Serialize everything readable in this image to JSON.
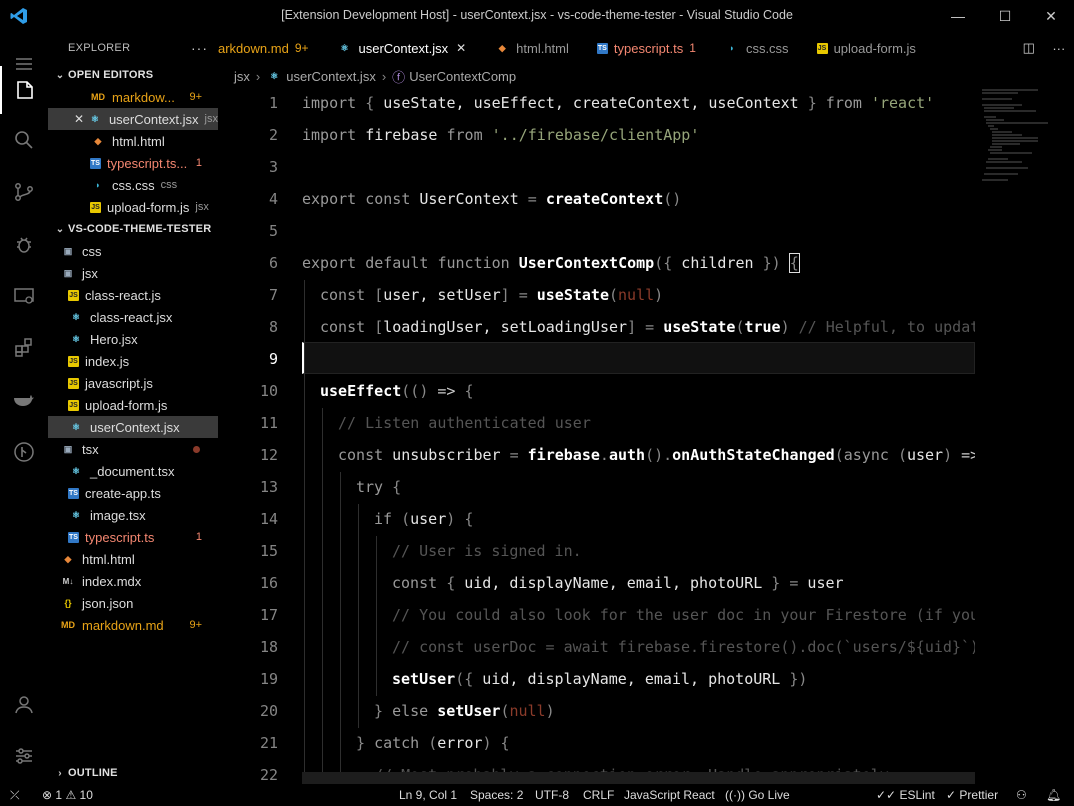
{
  "window": {
    "title": "[Extension Development Host] - userContext.jsx - vs-code-theme-tester - Visual Studio Code",
    "controls": {
      "minimize": "—",
      "maximize": "☐",
      "close": "✕"
    }
  },
  "activity_bar": {
    "items": [
      "files-icon",
      "search-icon",
      "source-control-icon",
      "debug-icon",
      "remote-explorer-icon",
      "extensions-icon",
      "docker-icon",
      "git-graph-icon"
    ],
    "bottom": [
      "account-icon",
      "settings-icon"
    ]
  },
  "sidebar": {
    "header": "EXPLORER",
    "more": "···",
    "open_editors": {
      "label": "OPEN EDITORS",
      "items": [
        {
          "name": "markdow...",
          "badge": "9+",
          "icon": "MD",
          "type": "md"
        },
        {
          "name": "userContext.jsx",
          "desc": "jsx",
          "icon": "⚛",
          "type": "react",
          "close": "✕"
        },
        {
          "name": "html.html",
          "icon": "◆",
          "type": "html"
        },
        {
          "name": "typescript.ts...",
          "badge": "1",
          "icon": "TS",
          "type": "ts"
        },
        {
          "name": "css.css",
          "desc": "css",
          "icon": "◗",
          "type": "css"
        },
        {
          "name": "upload-form.js",
          "desc": "jsx",
          "icon": "JS",
          "type": "js"
        }
      ]
    },
    "project": {
      "label": "VS-CODE-THEME-TESTER",
      "items": [
        {
          "name": "css",
          "icon": "▣",
          "type": "folder",
          "depth": 0
        },
        {
          "name": "jsx",
          "icon": "▣",
          "type": "folder",
          "depth": 0
        },
        {
          "name": "class-react.js",
          "icon": "JS",
          "type": "js",
          "depth": 1
        },
        {
          "name": "class-react.jsx",
          "icon": "⚛",
          "type": "react",
          "depth": 1
        },
        {
          "name": "Hero.jsx",
          "icon": "⚛",
          "type": "react",
          "depth": 1
        },
        {
          "name": "index.js",
          "icon": "JS",
          "type": "js",
          "depth": 1
        },
        {
          "name": "javascript.js",
          "icon": "JS",
          "type": "js",
          "depth": 1
        },
        {
          "name": "upload-form.js",
          "icon": "JS",
          "type": "js",
          "depth": 1
        },
        {
          "name": "userContext.jsx",
          "icon": "⚛",
          "type": "react",
          "depth": 1,
          "selected": true
        },
        {
          "name": "tsx",
          "icon": "▣",
          "type": "folder",
          "depth": 0,
          "dot": true
        },
        {
          "name": "_document.tsx",
          "icon": "⚛",
          "type": "react",
          "depth": 1
        },
        {
          "name": "create-app.ts",
          "icon": "TS",
          "type": "ts",
          "depth": 1
        },
        {
          "name": "image.tsx",
          "icon": "⚛",
          "type": "react",
          "depth": 1
        },
        {
          "name": "typescript.ts",
          "icon": "TS",
          "type": "ts",
          "depth": 1,
          "badge": "1",
          "error": true
        },
        {
          "name": "html.html",
          "icon": "◆",
          "type": "html",
          "depth": 0
        },
        {
          "name": "index.mdx",
          "icon": "M↓",
          "type": "mdx",
          "depth": 0
        },
        {
          "name": "json.json",
          "icon": "{}",
          "type": "json",
          "depth": 0
        },
        {
          "name": "markdown.md",
          "icon": "MD",
          "type": "md",
          "depth": 0,
          "badge": "9+",
          "warn": true
        }
      ]
    },
    "outline": "OUTLINE"
  },
  "tabs": [
    {
      "label": "arkdown.md",
      "num": "9+",
      "icon": "",
      "type": "md"
    },
    {
      "label": "userContext.jsx",
      "icon": "⚛",
      "type": "react",
      "active": true,
      "close": "✕"
    },
    {
      "label": "html.html",
      "icon": "◆",
      "type": "html"
    },
    {
      "label": "typescript.ts",
      "num": "1",
      "icon": "TS",
      "type": "ts"
    },
    {
      "label": "css.css",
      "icon": "◗",
      "type": "css"
    },
    {
      "label": "upload-form.js",
      "icon": "JS",
      "type": "js"
    }
  ],
  "breadcrumb": [
    "jsx",
    "userContext.jsx",
    "UserContextComp"
  ],
  "editor": {
    "current_line": 9,
    "line_numbers": [
      "1",
      "2",
      "3",
      "4",
      "5",
      "6",
      "7",
      "8",
      "9",
      "10",
      "11",
      "12",
      "13",
      "14",
      "15",
      "16",
      "17",
      "18",
      "19",
      "20",
      "21",
      "22"
    ]
  },
  "status": {
    "remote": "⤫",
    "errors": "1",
    "warnings": "10",
    "position": "Ln 9, Col 1",
    "spaces": "Spaces: 2",
    "encoding": "UTF-8",
    "eol": "CRLF",
    "language": "JavaScript React",
    "golive": "Go Live",
    "eslint": "ESLint",
    "prettier": "Prettier"
  },
  "colors": {
    "background": "#000000",
    "selection": "#3a3a3a",
    "accent_blue": "#2f9de8",
    "warning": "#e8a317",
    "error": "#f48771"
  }
}
